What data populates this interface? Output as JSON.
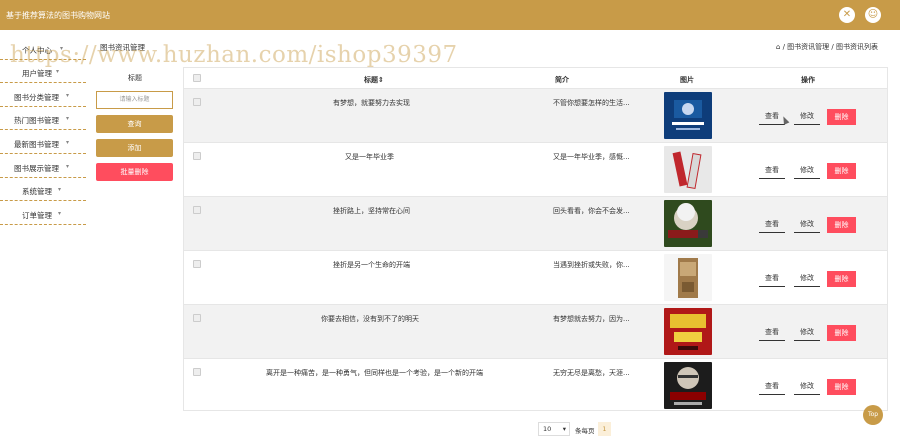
{
  "app": {
    "title": "基于推荐算法的图书购物网站"
  },
  "sidebar": {
    "items": [
      {
        "label": "个人中心"
      },
      {
        "label": "用户管理"
      },
      {
        "label": "图书分类管理"
      },
      {
        "label": "热门图书管理"
      },
      {
        "label": "最新图书管理"
      },
      {
        "label": "图书展示管理"
      },
      {
        "label": "系统管理"
      },
      {
        "label": "订单管理"
      }
    ]
  },
  "header": {
    "page_title": "图书资讯管理",
    "breadcrumb": "/ 图书资讯管理 / 图书资讯列表"
  },
  "watermark": "https://www.huzhan.com/ishop39397",
  "search": {
    "label": "标题",
    "placeholder": "请输入标题",
    "query_label": "查询",
    "add_label": "添加",
    "batch_delete_label": "批量删除"
  },
  "table": {
    "headers": {
      "title": "标题",
      "intro": "简介",
      "picture": "图片",
      "actions": "操作"
    },
    "rows": [
      {
        "title": "有梦想，就要努力去实现",
        "intro": "不管你想要怎样的生活...",
        "pic": "blue-book"
      },
      {
        "title": "又是一年毕业季",
        "intro": "又是一年毕业季，感慨...",
        "pic": "red-books"
      },
      {
        "title": "挫折路上，坚持常在心间",
        "intro": "回头看看，你会不会发...",
        "pic": "einstein-book"
      },
      {
        "title": "挫折是另一个生命的开端",
        "intro": "当遇到挫折或失败，你...",
        "pic": "wood-book"
      },
      {
        "title": "你要去相信，没有到不了的明天",
        "intro": "有梦想就去努力，因为...",
        "pic": "red-yellow-book"
      },
      {
        "title": "离开是一种痛苦，是一种勇气，但同样也是一个考验，是一个新的开端",
        "intro": "无穷无尽是离愁，天涯...",
        "pic": "portrait-book"
      }
    ],
    "actions": {
      "view": "查看",
      "edit": "修改",
      "delete": "删除"
    }
  },
  "pagination": {
    "page_size": "10",
    "per_page_label": "条每页",
    "page": "1"
  },
  "top_button": "Top",
  "colors": {
    "accent": "#c89b48",
    "danger": "#ff4d5e"
  }
}
